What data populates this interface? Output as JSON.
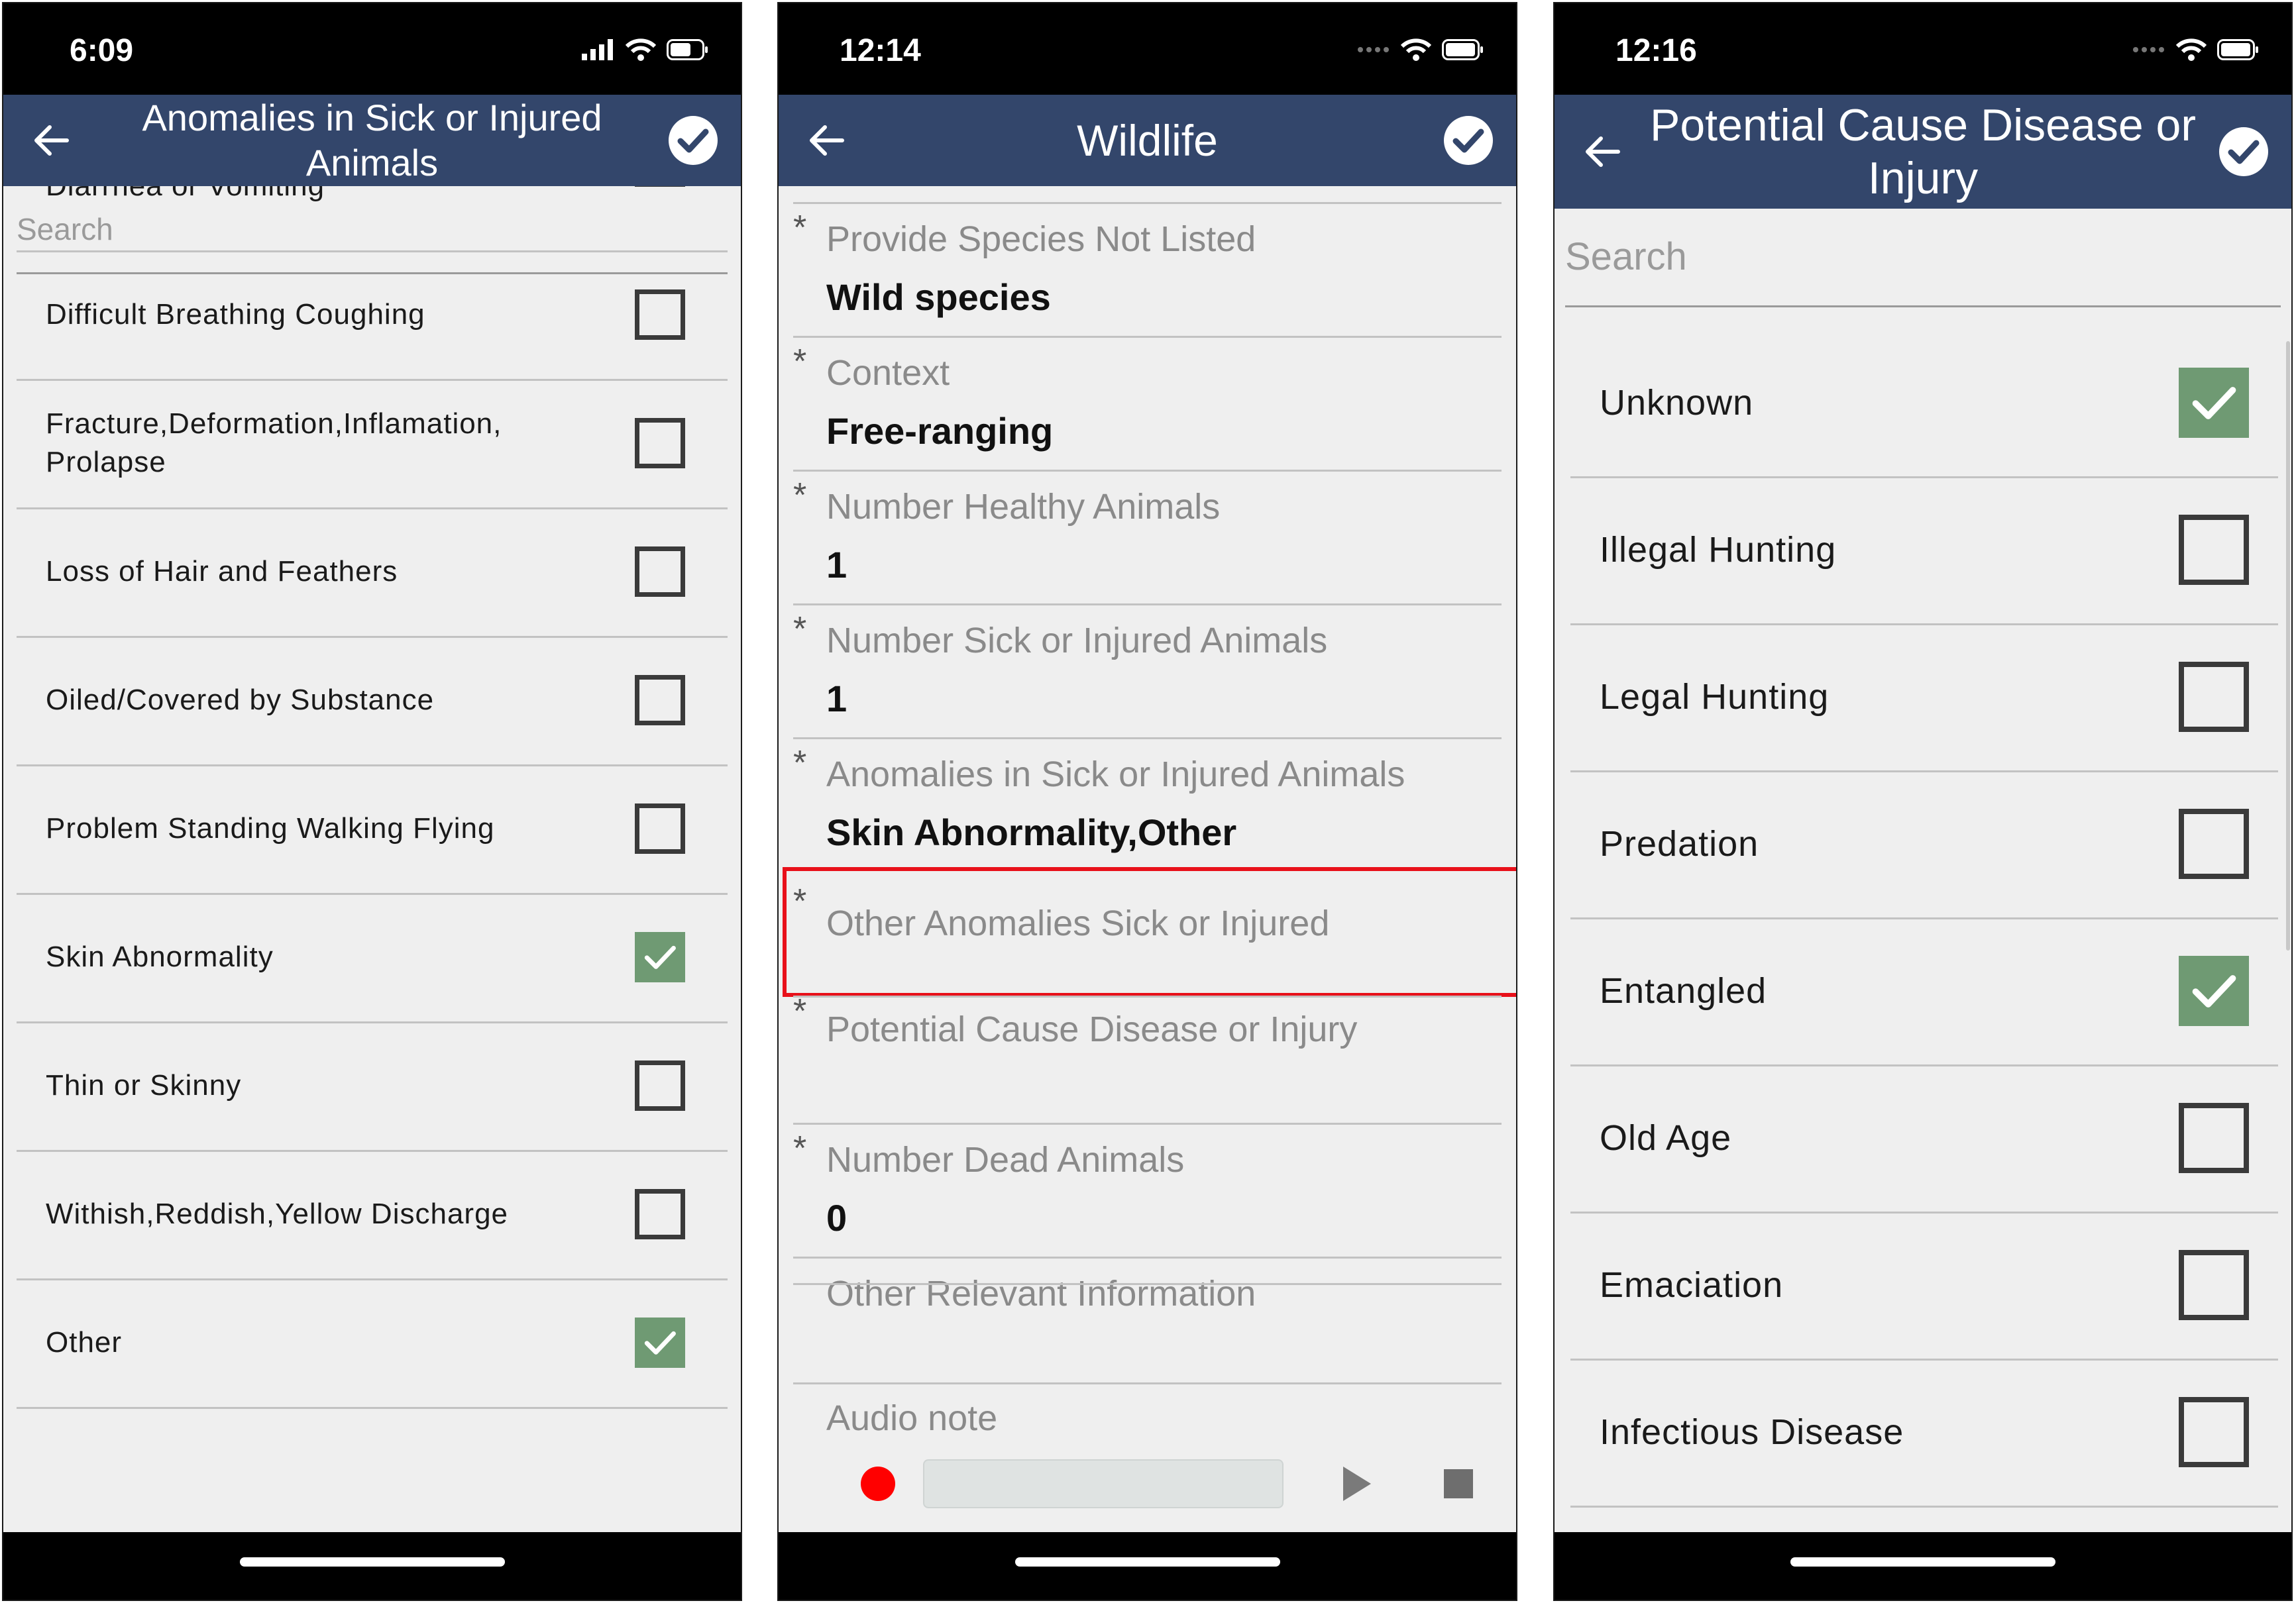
{
  "screens": [
    {
      "status_time": "6:09",
      "nav_title": "Anomalies in Sick or Injured Animals",
      "search_placeholder": "Search",
      "items": [
        {
          "label": "Diarrhea or Vomiting",
          "checked": false
        },
        {
          "label": "Difficult Breathing Coughing",
          "checked": false
        },
        {
          "label": "Fracture,Deformation,Inflamation, Prolapse",
          "checked": false
        },
        {
          "label": "Loss of Hair and Feathers",
          "checked": false
        },
        {
          "label": "Oiled/Covered by Substance",
          "checked": false
        },
        {
          "label": "Problem Standing Walking Flying",
          "checked": false
        },
        {
          "label": "Skin Abnormality",
          "checked": true
        },
        {
          "label": "Thin or Skinny",
          "checked": false
        },
        {
          "label": "Withish,Reddish,Yellow Discharge",
          "checked": false
        },
        {
          "label": "Other",
          "checked": true
        }
      ]
    },
    {
      "status_time": "12:14",
      "nav_title": "Wildlife",
      "fields": [
        {
          "label": "Provide Species Not Listed",
          "value": "Wild species",
          "required": true
        },
        {
          "label": "Context",
          "value": "Free-ranging",
          "required": true
        },
        {
          "label": "Number Healthy Animals",
          "value": "1",
          "required": true
        },
        {
          "label": "Number Sick or Injured Animals",
          "value": "1",
          "required": true
        },
        {
          "label": "Anomalies in Sick or Injured Animals",
          "value": "Skin Abnormality,Other",
          "required": true
        },
        {
          "label": "Other Anomalies Sick or Injured",
          "value": "",
          "required": true,
          "highlighted": true
        },
        {
          "label": "Potential Cause Disease or Injury",
          "value": "",
          "required": true
        },
        {
          "label": "Number Dead Animals",
          "value": "0",
          "required": true
        },
        {
          "label": "Other Relevant Information",
          "value": "",
          "required": false
        },
        {
          "label": "Audio note",
          "value": "",
          "required": false
        }
      ]
    },
    {
      "status_time": "12:16",
      "nav_title": "Potential Cause Disease or Injury",
      "search_placeholder": "Search",
      "items": [
        {
          "label": "Unknown",
          "checked": true
        },
        {
          "label": "Illegal Hunting",
          "checked": false
        },
        {
          "label": "Legal Hunting",
          "checked": false
        },
        {
          "label": "Predation",
          "checked": false
        },
        {
          "label": "Entangled",
          "checked": true
        },
        {
          "label": "Old Age",
          "checked": false
        },
        {
          "label": "Emaciation",
          "checked": false
        },
        {
          "label": "Infectious Disease",
          "checked": false
        }
      ]
    }
  ],
  "icons": {
    "back": "arrow-left-icon",
    "done": "check-circle-icon",
    "signal": "cellular-signal-icon",
    "wifi": "wifi-icon",
    "battery": "battery-icon",
    "record": "record-icon",
    "play": "play-icon",
    "stop": "stop-icon"
  },
  "colors": {
    "nav_bar": "#33466b",
    "checked_box": "#6f9a73",
    "highlight": "#e8101a",
    "record": "#ff0000",
    "background": "#efefef"
  }
}
